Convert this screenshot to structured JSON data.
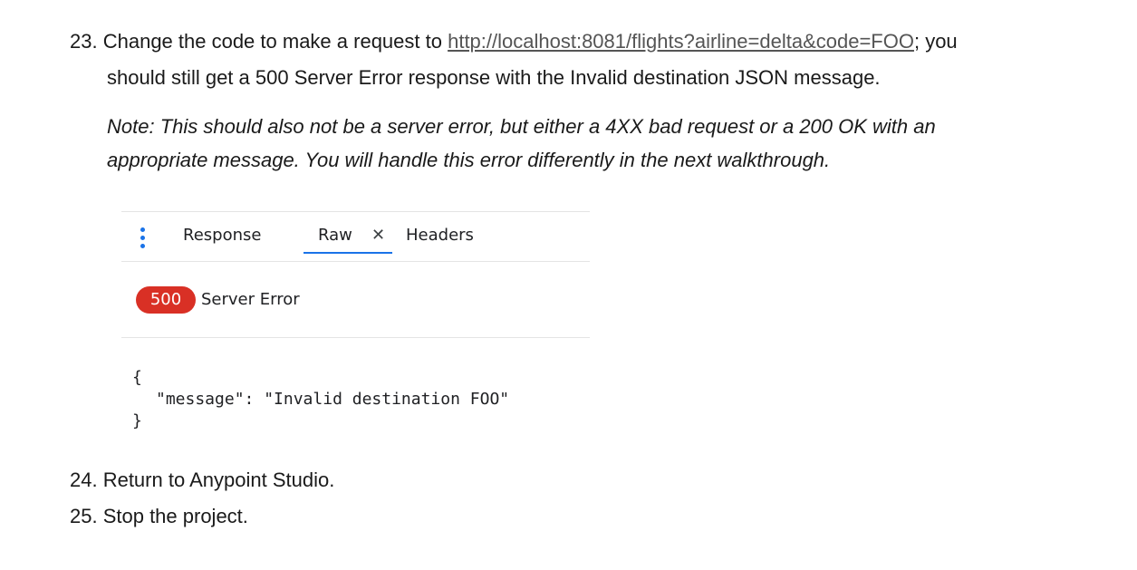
{
  "steps": {
    "s23": {
      "number": "23.",
      "text_before": "Change the code to make a request to",
      "url": "http://localhost:8081/flights?airline=delta&code=FOO",
      "text_after": "; you",
      "line2": "should still get a 500 Server Error response with the Invalid destination JSON message."
    },
    "note": {
      "line1": "Note: This should also not be a server error, but either a 4XX bad request or a 200 OK with an",
      "line2": "appropriate message. You will handle this error differently in the next walkthrough."
    },
    "s24": "24. Return to Anypoint Studio.",
    "s25": "25. Stop the project."
  },
  "panel": {
    "tabs": {
      "response": "Response",
      "raw": "Raw",
      "close": "✕",
      "headers": "Headers"
    },
    "menu_icon": "more-vert-icon",
    "status": {
      "code": "500",
      "text": "Server Error",
      "color": "#d93025"
    },
    "body": {
      "open": "{",
      "line": "\"message\": \"Invalid destination FOO\"",
      "close": "}"
    },
    "accent": "#1a73e8"
  }
}
